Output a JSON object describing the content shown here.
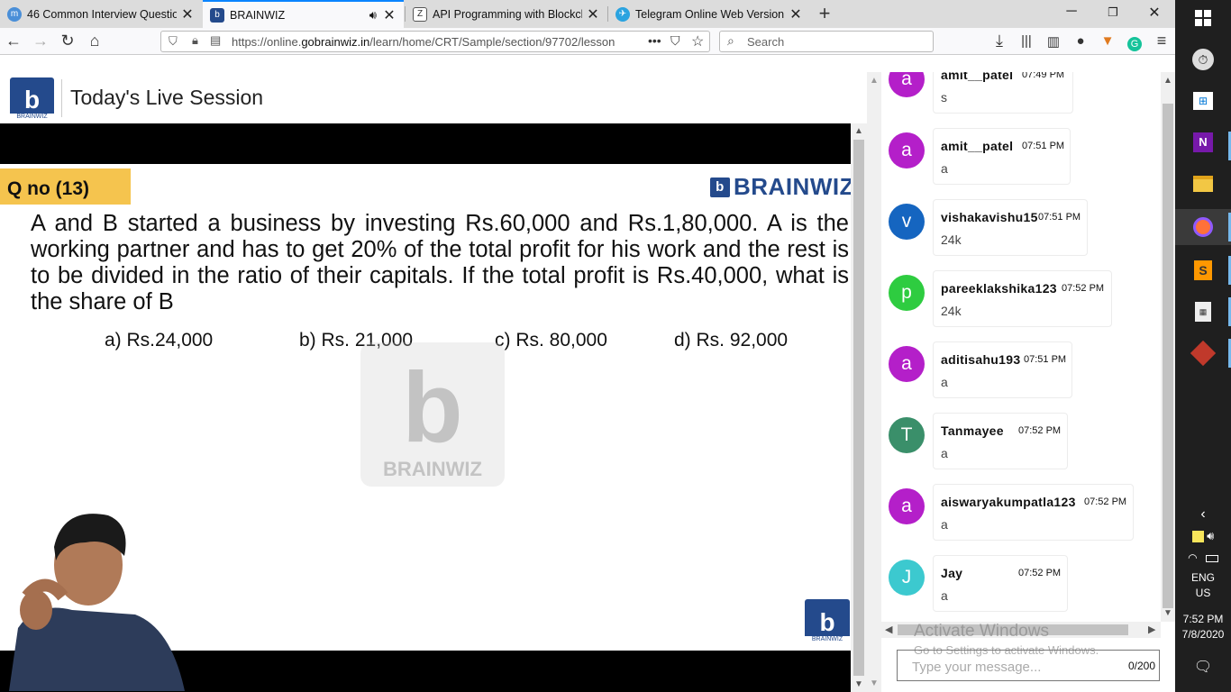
{
  "browser": {
    "tabs": [
      {
        "title": "46 Common Interview Question",
        "icon": "m",
        "icon_color": "#4a8fd8"
      },
      {
        "title": "BRAINWIZ",
        "icon": "b",
        "icon_color": "#244a8c"
      },
      {
        "title": "API Programming with Blockch",
        "icon": "Z",
        "icon_color": "#555555"
      },
      {
        "title": "Telegram Online Web Version",
        "icon": "✈",
        "icon_color": "#2aa3e0"
      }
    ],
    "url_prefix": "https://online.",
    "url_domain": "gobrainwiz.in",
    "url_path": "/learn/home/CRT/Sample/section/97702/lesson",
    "search_placeholder": "Search"
  },
  "page": {
    "title": "Today's Live Session",
    "logo_text": "BRAINWIZ"
  },
  "slide": {
    "qno": "Q no (13)",
    "brand": "BRAINWIZ",
    "question": "A and B started a business by investing Rs.60,000 and Rs.1,80,000. A is the working partner and has to get 20% of the total profit for his work and the rest is to be divided in the ratio of their capitals. If the total profit is Rs.40,000, what is the share of B",
    "options": [
      "a) Rs.24,000",
      "b) Rs. 21,000",
      "c) Rs. 80,000",
      "d) Rs. 92,000"
    ],
    "watermark_text": "BRAINWIZ",
    "corner_logo_text": "BRAINWIZ"
  },
  "chat": {
    "messages": [
      {
        "avatar": "a",
        "color": "#b41fc9",
        "user": "amit__patel",
        "time": "07:49 PM",
        "text": "s"
      },
      {
        "avatar": "a",
        "color": "#b41fc9",
        "user": "amit__patel",
        "time": "07:51 PM",
        "text": "a"
      },
      {
        "avatar": "v",
        "color": "#1565c0",
        "user": "vishakavishu15",
        "time": "07:51 PM",
        "text": "24k"
      },
      {
        "avatar": "p",
        "color": "#2ecc40",
        "user": "pareeklakshika123",
        "time": "07:52 PM",
        "text": "24k"
      },
      {
        "avatar": "a",
        "color": "#b41fc9",
        "user": "aditisahu193",
        "time": "07:51 PM",
        "text": "a"
      },
      {
        "avatar": "T",
        "color": "#3a8f6a",
        "user": "Tanmayee",
        "time": "07:52 PM",
        "text": "a"
      },
      {
        "avatar": "a",
        "color": "#b41fc9",
        "user": "aiswaryakumpatla123",
        "time": "07:52 PM",
        "text": "a"
      },
      {
        "avatar": "J",
        "color": "#3cc9cf",
        "user": "Jay",
        "time": "07:52 PM",
        "text": "a"
      }
    ],
    "input_placeholder": "Type your message...",
    "char_count": "0/200",
    "activate_line1": "Activate Windows",
    "activate_line2": "Go to Settings to activate Windows."
  },
  "taskbar": {
    "lang": "ENG",
    "region": "US",
    "time": "7:52 PM",
    "date": "7/8/2020"
  }
}
